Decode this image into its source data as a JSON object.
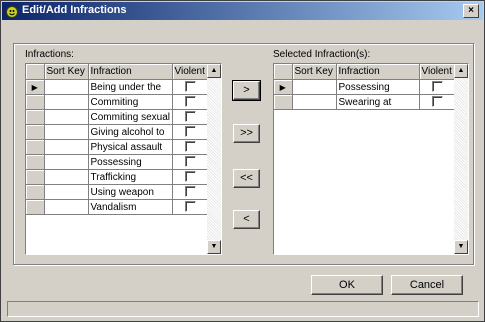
{
  "window": {
    "title": "Edit/Add Infractions",
    "close_label": "×"
  },
  "left": {
    "label": "Infractions:",
    "columns": [
      "Sort Key",
      "Infraction",
      "Violent"
    ],
    "rows": [
      {
        "sort_key": "",
        "infraction": "Being under the",
        "violent": false,
        "current": true
      },
      {
        "sort_key": "",
        "infraction": "Commiting",
        "violent": false
      },
      {
        "sort_key": "",
        "infraction": "Commiting sexual",
        "violent": false
      },
      {
        "sort_key": "",
        "infraction": "Giving alcohol to",
        "violent": false
      },
      {
        "sort_key": "",
        "infraction": "Physical assault",
        "violent": false
      },
      {
        "sort_key": "",
        "infraction": "Possessing",
        "violent": false
      },
      {
        "sort_key": "",
        "infraction": "Trafficking",
        "violent": false
      },
      {
        "sort_key": "",
        "infraction": "Using weapon",
        "violent": false
      },
      {
        "sort_key": "",
        "infraction": "Vandalism",
        "violent": false
      }
    ]
  },
  "right": {
    "label": "Selected Infraction(s):",
    "columns": [
      "Sort Key",
      "Infraction",
      "Violent"
    ],
    "rows": [
      {
        "sort_key": "",
        "infraction": "Possessing",
        "violent": false,
        "current": true
      },
      {
        "sort_key": "",
        "infraction": "Swearing at",
        "violent": false
      }
    ]
  },
  "move_buttons": {
    "add_one": ">",
    "add_all": ">>",
    "remove_all": "<<",
    "remove_one": "<"
  },
  "footer": {
    "ok_label": "OK",
    "cancel_label": "Cancel"
  }
}
